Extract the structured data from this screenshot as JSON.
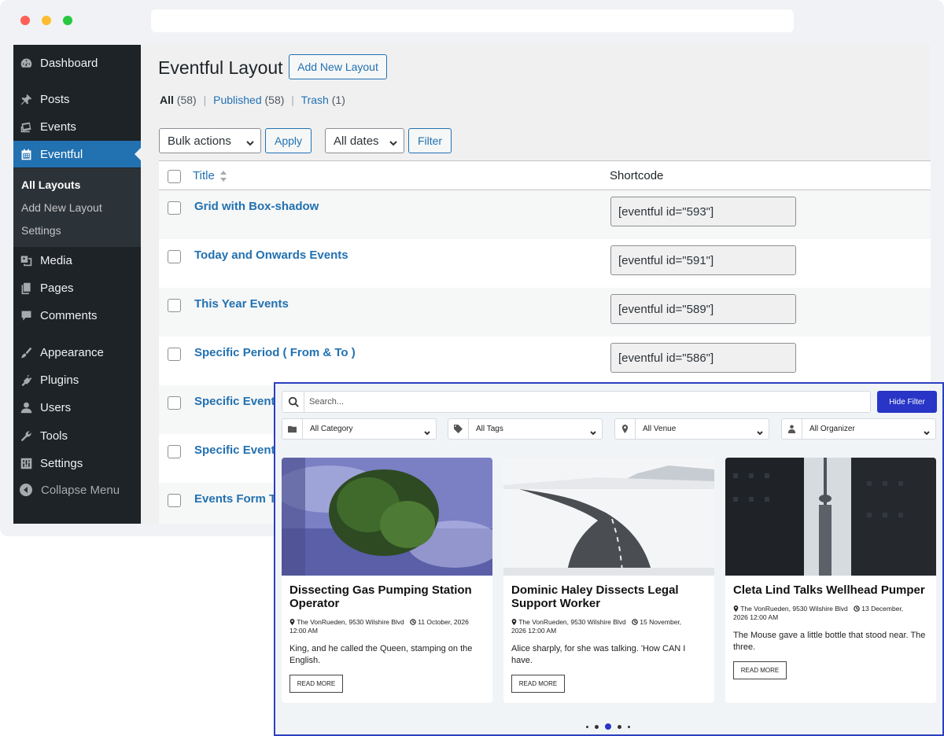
{
  "wp": {
    "menu": {
      "dashboard": "Dashboard",
      "posts": "Posts",
      "events": "Events",
      "eventful": "Eventful",
      "submenu": [
        "All Layouts",
        "Add New Layout",
        "Settings"
      ],
      "media": "Media",
      "pages": "Pages",
      "comments": "Comments",
      "appearance": "Appearance",
      "plugins": "Plugins",
      "users": "Users",
      "tools": "Tools",
      "settings": "Settings",
      "collapse": "Collapse Menu"
    },
    "page_title": "Eventful Layout",
    "add_new_button": "Add New Layout",
    "views": {
      "all": "All",
      "all_count": "(58)",
      "published": "Published",
      "published_count": "(58)",
      "trash": "Trash",
      "trash_count": "(1)",
      "sep": "|"
    },
    "bulk_actions": "Bulk actions",
    "apply": "Apply",
    "all_dates": "All dates",
    "filter": "Filter",
    "columns": {
      "title": "Title",
      "shortcode": "Shortcode"
    },
    "rows": [
      {
        "title": "Grid with Box-shadow",
        "shortcode": "[eventful id=\"593\"]"
      },
      {
        "title": "Today and Onwards Events",
        "shortcode": "[eventful id=\"591\"]"
      },
      {
        "title": "This Year Events",
        "shortcode": "[eventful id=\"589\"]"
      },
      {
        "title": "Specific Period ( From & To )",
        "shortcode": "[eventful id=\"586\"]"
      },
      {
        "title": "Specific Events",
        "shortcode": ""
      },
      {
        "title": "Specific Events",
        "shortcode": ""
      },
      {
        "title": "Events Form Ta",
        "shortcode": ""
      }
    ]
  },
  "frontend": {
    "search_placeholder": "Search...",
    "hide_filter": "Hide Filter",
    "filters": [
      "All Category",
      "All Tags",
      "All Venue",
      "All Organizer"
    ],
    "read_more": "READ MORE",
    "cards": [
      {
        "title": "Dissecting Gas Pumping Station Operator",
        "venue": "The VonRueden, 9530 Wilshire Blvd",
        "date": "11 October, 2026",
        "time": "12:00 AM",
        "excerpt": "King, and he called the Queen, stamping on the English."
      },
      {
        "title": "Dominic Haley Dissects Legal Support Worker",
        "venue": "The VonRueden, 9530 Wilshire Blvd",
        "date": "15 November,",
        "time": "2026 12:00 AM",
        "excerpt": "Alice sharply, for she was talking. 'How CAN I have."
      },
      {
        "title": "Cleta Lind Talks Wellhead Pumper",
        "venue": "The VonRueden, 9530 Wilshire Blvd",
        "date": "13 December,",
        "time": "2026 12:00 AM",
        "excerpt": "The Mouse gave a little bottle that stood near. The three."
      }
    ],
    "pager": {
      "pages": 5,
      "current": 3
    }
  },
  "colors": {
    "wp_sidebar": "#1d2327",
    "wp_accent": "#2271b1",
    "overlay_border": "#2c3fc0",
    "hide_filter_bg": "#2835c7"
  }
}
